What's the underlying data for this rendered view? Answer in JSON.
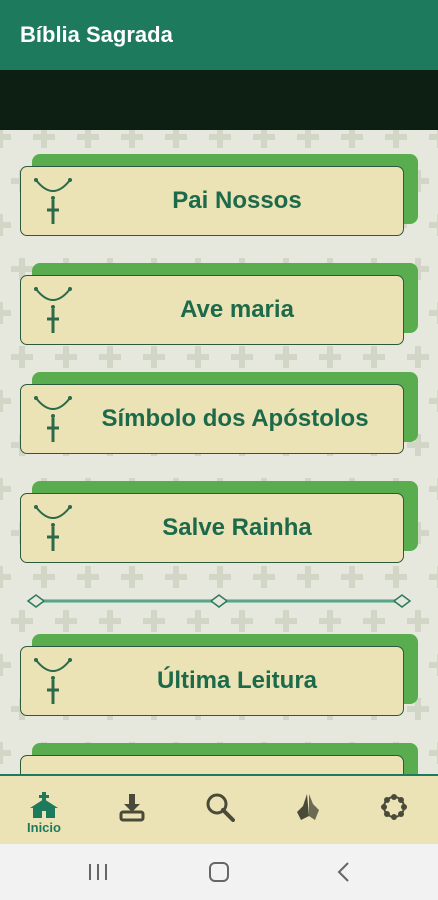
{
  "app": {
    "title": "Bíblia Sagrada"
  },
  "cards": [
    {
      "label": "Pai Nossos",
      "icon": "rosary-icon"
    },
    {
      "label": "Ave maria",
      "icon": "rosary-icon"
    },
    {
      "label": "Símbolo dos Apóstolos",
      "icon": "rosary-icon"
    },
    {
      "label": "Salve Rainha",
      "icon": "rosary-icon"
    },
    {
      "label": "Última Leitura",
      "icon": "rosary-icon"
    }
  ],
  "bottom_nav": {
    "items": [
      {
        "label": "Inicio",
        "icon": "church-icon",
        "active": true
      },
      {
        "label": "",
        "icon": "bookmark-download-icon"
      },
      {
        "label": "",
        "icon": "search-icon"
      },
      {
        "label": "",
        "icon": "praying-hands-icon"
      },
      {
        "label": "",
        "icon": "rosary-circle-icon"
      }
    ]
  },
  "system_nav": [
    "recent-apps",
    "home",
    "back"
  ],
  "colors": {
    "primary": "#1e7a5c",
    "card_fill": "#ebe3b5",
    "card_shadow": "#5aad4e",
    "text": "#1d6a4a"
  }
}
